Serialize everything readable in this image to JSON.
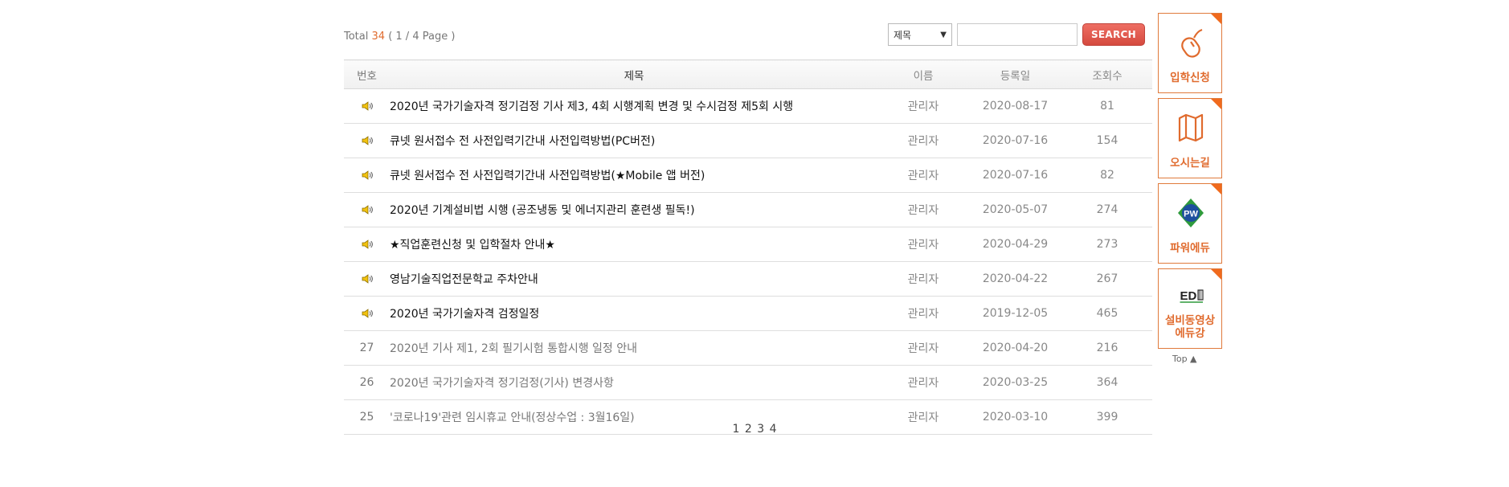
{
  "total": {
    "label": "Total",
    "count": "34",
    "pages": "( 1 / 4 Page )"
  },
  "search": {
    "select_value": "제목",
    "input_value": "",
    "button_label": "SEARCH"
  },
  "table": {
    "headers": [
      "번호",
      "제목",
      "이름",
      "등록일",
      "조회수"
    ],
    "rows": [
      {
        "num": "",
        "notice": true,
        "title": "2020년 국가기술자격 정기검정 기사 제3, 4회 시행계획 변경 및 수시검정 제5회 시행",
        "name": "관리자",
        "date": "2020-08-17",
        "views": "81"
      },
      {
        "num": "",
        "notice": true,
        "title": "큐넷 원서접수 전 사전입력기간내 사전입력방법(PC버전)",
        "name": "관리자",
        "date": "2020-07-16",
        "views": "154"
      },
      {
        "num": "",
        "notice": true,
        "title": "큐넷 원서접수 전 사전입력기간내 사전입력방법(★Mobile 앱 버전)",
        "name": "관리자",
        "date": "2020-07-16",
        "views": "82"
      },
      {
        "num": "",
        "notice": true,
        "title": "2020년 기계설비법 시행 (공조냉동 및 에너지관리 훈련생 필독!)",
        "name": "관리자",
        "date": "2020-05-07",
        "views": "274"
      },
      {
        "num": "",
        "notice": true,
        "title": "★직업훈련신청 및 입학절차 안내★",
        "name": "관리자",
        "date": "2020-04-29",
        "views": "273"
      },
      {
        "num": "",
        "notice": true,
        "title": "영남기술직업전문학교 주차안내",
        "name": "관리자",
        "date": "2020-04-22",
        "views": "267"
      },
      {
        "num": "",
        "notice": true,
        "title": "2020년 국가기술자격 검정일정",
        "name": "관리자",
        "date": "2019-12-05",
        "views": "465"
      },
      {
        "num": "27",
        "notice": false,
        "title": "2020년 기사 제1, 2회 필기시험 통합시행 일정 안내",
        "name": "관리자",
        "date": "2020-04-20",
        "views": "216"
      },
      {
        "num": "26",
        "notice": false,
        "title": "2020년 국가기술자격 정기검정(기사) 변경사항",
        "name": "관리자",
        "date": "2020-03-25",
        "views": "364"
      },
      {
        "num": "25",
        "notice": false,
        "title": "'코로나19'관련 임시휴교 안내(정상수업 : 3월16일)",
        "name": "관리자",
        "date": "2020-03-10",
        "views": "399"
      }
    ]
  },
  "pagination": [
    "1",
    "2",
    "3",
    "4"
  ],
  "quick_menu": [
    {
      "label": "입학신청",
      "icon": "mouse-icon"
    },
    {
      "label": "오시는길",
      "icon": "map-icon"
    },
    {
      "label": "파워에듀",
      "icon": "pw-logo-icon"
    },
    {
      "label": "설비동영상 에듀강",
      "icon": "ed-logo-icon"
    }
  ],
  "top_label": "Top ▲"
}
